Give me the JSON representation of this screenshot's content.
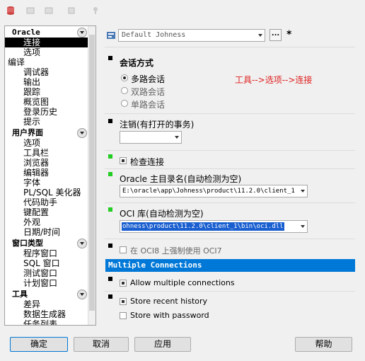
{
  "toolbar": {
    "icons": [
      "db-icon",
      "tool-icon-1",
      "tool-icon-2",
      "tool-icon-3",
      "pin-icon"
    ]
  },
  "sidebar": {
    "groups": [
      {
        "label": "Oracle",
        "items": [
          "连接",
          "选项"
        ]
      },
      {
        "label": "",
        "top_item": "编译",
        "items": [
          "调试器",
          "输出",
          "跟踪",
          "概览图",
          "登录历史",
          "提示"
        ]
      },
      {
        "label": "用户界面",
        "items": [
          "选项",
          "工具栏",
          "浏览器",
          "编辑器",
          "字体",
          "PL/SQL 美化器",
          "代码助手",
          "键配置",
          "外观",
          "日期/时间"
        ]
      },
      {
        "label": "窗口类型",
        "items": [
          "程序窗口",
          "SQL 窗口",
          "测试窗口",
          "计划窗口"
        ]
      },
      {
        "label": "工具",
        "items": [
          "差异",
          "数据生成器",
          "任务列表"
        ]
      }
    ]
  },
  "main": {
    "profile_value": "Default Johness",
    "dots_label": "...",
    "star_label": "*",
    "session_mode": {
      "title": "会话方式",
      "options": [
        "多路会话",
        "双路会话",
        "单路会话"
      ],
      "selected": 0
    },
    "logoff": {
      "title": "注销(有打开的事务)",
      "value": ""
    },
    "check_connection": {
      "label": "检查连接",
      "checked": true
    },
    "oracle_home": {
      "title": "Oracle 主目录名(自动检测为空)",
      "value": "E:\\oracle\\app\\Johness\\product\\11.2.0\\client_1"
    },
    "oci_library": {
      "title": "OCI 库(自动检测为空)",
      "value": "ohness\\product\\11.2.0\\client_1\\bin\\oci.dll"
    },
    "force_oci7": {
      "label": "在 OCI8 上强制使用 OCI7",
      "checked": false
    },
    "multiple_connections_header": "Multiple Connections",
    "allow_multiple": {
      "label": "Allow multiple connections",
      "checked": true
    },
    "store_recent": {
      "label": "Store recent history",
      "checked": true
    },
    "store_password": {
      "label": "Store with password",
      "checked": false
    }
  },
  "annotation": "工具-->选项-->连接",
  "buttons": {
    "ok": "确定",
    "cancel": "取消",
    "apply": "应用",
    "help": "帮助"
  },
  "colors": {
    "selection": "#000000",
    "header_bar": "#0078d7",
    "annotation": "#e02020",
    "bullet_green": "#22cc22"
  }
}
